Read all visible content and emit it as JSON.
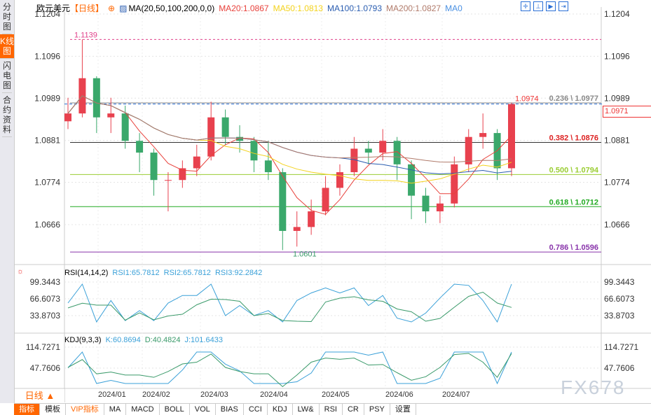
{
  "sidebar": {
    "items": [
      {
        "label": "分时图"
      },
      {
        "label": "K线图",
        "active": true
      },
      {
        "label": "闪电图"
      },
      {
        "label": "合约资料"
      }
    ]
  },
  "header": {
    "symbol": "欧元美元",
    "period": "【日线】",
    "ma_label": "MA(20,50,100,200,0,0)",
    "ma20": "MA20:1.0867",
    "ma50": "MA50:1.0813",
    "ma100": "MA100:1.0793",
    "ma200": "MA200:1.0827",
    "ma0": "MA0"
  },
  "colors": {
    "ma20": "#e8413b",
    "ma50": "#f3d21c",
    "ma100": "#2a5db0",
    "ma200": "#b07a6a",
    "up": "#e8414e",
    "down": "#3aa86b",
    "fib_0236": "#888888",
    "fib_0382": "#333333",
    "fib_0500": "#9acd32",
    "fib_0618": "#22aa22",
    "fib_0786": "#8833aa"
  },
  "rsi": {
    "label": "RSI(14,14,2)",
    "rsi1": "RSI1:65.7812",
    "rsi2": "RSI2:65.7812",
    "rsi3": "RSI3:92.2842",
    "ticks": [
      "99.3443",
      "66.6073",
      "33.8703"
    ]
  },
  "kdj": {
    "label": "KDJ(9,3,3)",
    "k": "K:60.8694",
    "d": "D:40.4824",
    "j": "J:101.6433",
    "ticks": [
      "114.7271",
      "47.7606"
    ]
  },
  "price": {
    "current": "1.0971",
    "ticks": [
      "1.1204",
      "1.1096",
      "1.0989",
      "1.0881",
      "1.0774",
      "1.0666"
    ],
    "high_label": "1.1139",
    "low_label": "1.0601",
    "last_label": "1.0974"
  },
  "fib": [
    {
      "label": "0.236 \\ 1.0977",
      "value": 1.0977
    },
    {
      "label": "0.382 \\ 1.0876",
      "value": 1.0876
    },
    {
      "label": "0.500 \\ 1.0794",
      "value": 1.0794
    },
    {
      "label": "0.618 \\ 1.0712",
      "value": 1.0712
    },
    {
      "label": "0.786 \\ 1.0596",
      "value": 1.0596
    }
  ],
  "chart_data": {
    "type": "candlestick",
    "ohlc": [
      [
        1.093,
        1.099,
        1.091,
        1.095
      ],
      [
        1.095,
        1.1139,
        1.094,
        1.104
      ],
      [
        1.104,
        1.1045,
        1.09,
        1.094
      ],
      [
        1.094,
        1.099,
        1.09,
        1.095
      ],
      [
        1.095,
        1.097,
        1.086,
        1.088
      ],
      [
        1.088,
        1.09,
        1.08,
        1.085
      ],
      [
        1.085,
        1.086,
        1.074,
        1.078
      ],
      [
        1.078,
        1.08,
        1.07,
        1.078
      ],
      [
        1.078,
        1.083,
        1.076,
        1.081
      ],
      [
        1.081,
        1.087,
        1.079,
        1.084
      ],
      [
        1.084,
        1.098,
        1.083,
        1.094
      ],
      [
        1.094,
        1.096,
        1.087,
        1.089
      ],
      [
        1.089,
        1.092,
        1.085,
        1.088
      ],
      [
        1.088,
        1.089,
        1.08,
        1.083
      ],
      [
        1.083,
        1.088,
        1.078,
        1.08
      ],
      [
        1.08,
        1.081,
        1.0601,
        1.065
      ],
      [
        1.065,
        1.07,
        1.061,
        1.066
      ],
      [
        1.066,
        1.073,
        1.064,
        1.07
      ],
      [
        1.07,
        1.079,
        1.069,
        1.076
      ],
      [
        1.076,
        1.082,
        1.074,
        1.08
      ],
      [
        1.08,
        1.089,
        1.079,
        1.086
      ],
      [
        1.086,
        1.088,
        1.082,
        1.085
      ],
      [
        1.085,
        1.091,
        1.083,
        1.088
      ],
      [
        1.088,
        1.089,
        1.078,
        1.082
      ],
      [
        1.082,
        1.083,
        1.068,
        1.074
      ],
      [
        1.074,
        1.076,
        1.067,
        1.07
      ],
      [
        1.07,
        1.074,
        1.067,
        1.072
      ],
      [
        1.072,
        1.084,
        1.071,
        1.082
      ],
      [
        1.082,
        1.091,
        1.08,
        1.089
      ],
      [
        1.089,
        1.095,
        1.086,
        1.09
      ],
      [
        1.09,
        1.091,
        1.078,
        1.081
      ],
      [
        1.081,
        1.0978,
        1.079,
        1.0974
      ]
    ],
    "x_labels": [
      "2024/01",
      "2024/02",
      "2024/03",
      "2024/04",
      "2024/05",
      "2024/06",
      "2024/07"
    ],
    "ylim": [
      1.056,
      1.123
    ]
  },
  "bottom": {
    "period": "日线 ▲",
    "tabs": [
      "指标",
      "模板",
      "VIP指标",
      "MA",
      "MACD",
      "BOLL",
      "VOL",
      "BIAS",
      "CCI",
      "KDJ",
      "LW&",
      "RSI",
      "CR",
      "PSY",
      "设置"
    ]
  },
  "watermark": "FX678"
}
